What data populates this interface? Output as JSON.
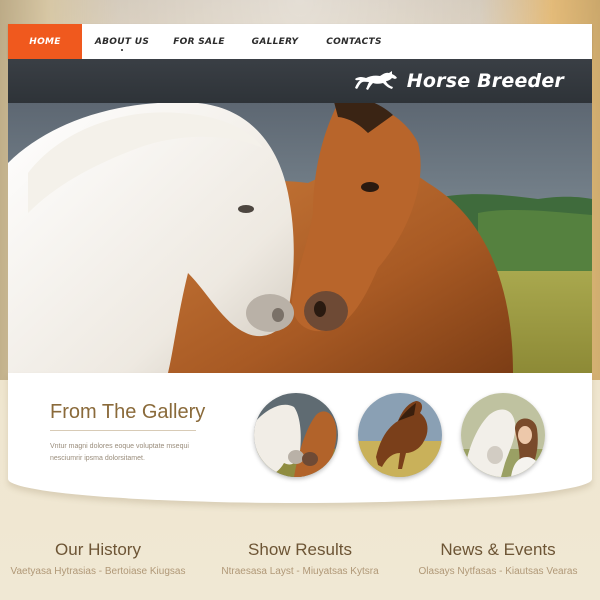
{
  "nav": {
    "items": [
      {
        "label": "HOME",
        "active": true
      },
      {
        "label": "ABOUT US"
      },
      {
        "label": "FOR SALE"
      },
      {
        "label": "GALLERY"
      },
      {
        "label": "CONTACTS"
      }
    ]
  },
  "header": {
    "logo_icon": "running-horse-icon",
    "title": "Horse Breeder"
  },
  "hero": {
    "image": "white-and-chestnut-horses-nuzzling"
  },
  "gallery": {
    "title": "From The Gallery",
    "text": "Vntur magni dolores eoque voluptate msequi nesciumrir ipsma dolorsitamet.",
    "thumbnails": [
      {
        "image": "two-horses-thumbnail"
      },
      {
        "image": "bay-horse-rearing-thumbnail"
      },
      {
        "image": "girl-with-white-horse-thumbnail"
      }
    ]
  },
  "columns": [
    {
      "title": "Our History",
      "subtitle": "Vaetyasa Hytrasias - Bertoiase Kiugsas"
    },
    {
      "title": "Show Results",
      "subtitle": "Ntraesasa Layst - Miuyatsas Kytsra"
    },
    {
      "title": "News & Events",
      "subtitle": "Olasays Nytfasas - Kiautsas Vearas"
    }
  ],
  "colors": {
    "accent": "#f0591e",
    "header_bar": "#2e3338",
    "heading_brown": "#6d5535"
  }
}
